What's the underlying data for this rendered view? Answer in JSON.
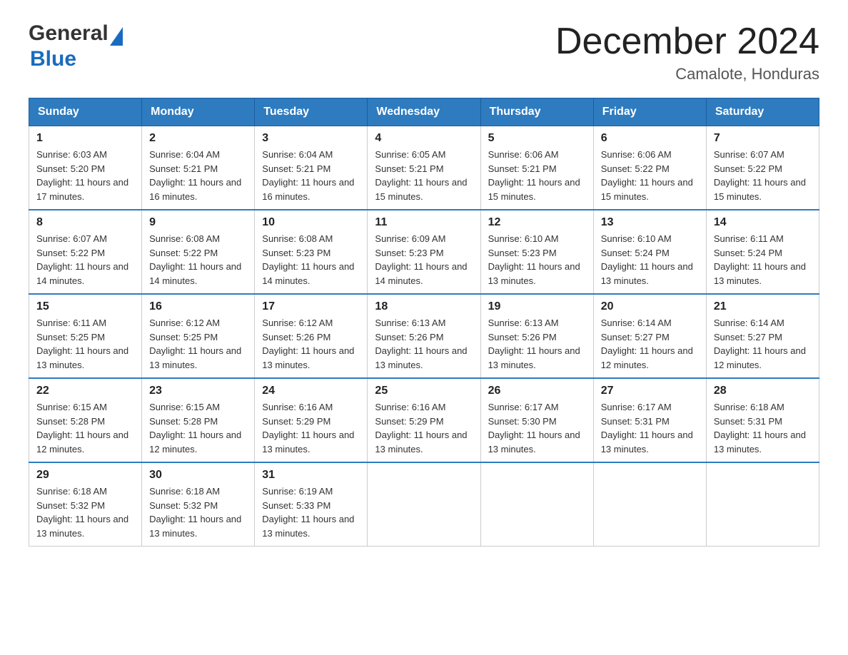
{
  "header": {
    "logo": {
      "text_general": "General",
      "text_blue": "Blue",
      "aria": "GeneralBlue logo"
    },
    "title": "December 2024",
    "subtitle": "Camalote, Honduras"
  },
  "calendar": {
    "weekdays": [
      "Sunday",
      "Monday",
      "Tuesday",
      "Wednesday",
      "Thursday",
      "Friday",
      "Saturday"
    ],
    "weeks": [
      [
        {
          "day": "1",
          "sunrise": "6:03 AM",
          "sunset": "5:20 PM",
          "daylight": "11 hours and 17 minutes."
        },
        {
          "day": "2",
          "sunrise": "6:04 AM",
          "sunset": "5:21 PM",
          "daylight": "11 hours and 16 minutes."
        },
        {
          "day": "3",
          "sunrise": "6:04 AM",
          "sunset": "5:21 PM",
          "daylight": "11 hours and 16 minutes."
        },
        {
          "day": "4",
          "sunrise": "6:05 AM",
          "sunset": "5:21 PM",
          "daylight": "11 hours and 15 minutes."
        },
        {
          "day": "5",
          "sunrise": "6:06 AM",
          "sunset": "5:21 PM",
          "daylight": "11 hours and 15 minutes."
        },
        {
          "day": "6",
          "sunrise": "6:06 AM",
          "sunset": "5:22 PM",
          "daylight": "11 hours and 15 minutes."
        },
        {
          "day": "7",
          "sunrise": "6:07 AM",
          "sunset": "5:22 PM",
          "daylight": "11 hours and 15 minutes."
        }
      ],
      [
        {
          "day": "8",
          "sunrise": "6:07 AM",
          "sunset": "5:22 PM",
          "daylight": "11 hours and 14 minutes."
        },
        {
          "day": "9",
          "sunrise": "6:08 AM",
          "sunset": "5:22 PM",
          "daylight": "11 hours and 14 minutes."
        },
        {
          "day": "10",
          "sunrise": "6:08 AM",
          "sunset": "5:23 PM",
          "daylight": "11 hours and 14 minutes."
        },
        {
          "day": "11",
          "sunrise": "6:09 AM",
          "sunset": "5:23 PM",
          "daylight": "11 hours and 14 minutes."
        },
        {
          "day": "12",
          "sunrise": "6:10 AM",
          "sunset": "5:23 PM",
          "daylight": "11 hours and 13 minutes."
        },
        {
          "day": "13",
          "sunrise": "6:10 AM",
          "sunset": "5:24 PM",
          "daylight": "11 hours and 13 minutes."
        },
        {
          "day": "14",
          "sunrise": "6:11 AM",
          "sunset": "5:24 PM",
          "daylight": "11 hours and 13 minutes."
        }
      ],
      [
        {
          "day": "15",
          "sunrise": "6:11 AM",
          "sunset": "5:25 PM",
          "daylight": "11 hours and 13 minutes."
        },
        {
          "day": "16",
          "sunrise": "6:12 AM",
          "sunset": "5:25 PM",
          "daylight": "11 hours and 13 minutes."
        },
        {
          "day": "17",
          "sunrise": "6:12 AM",
          "sunset": "5:26 PM",
          "daylight": "11 hours and 13 minutes."
        },
        {
          "day": "18",
          "sunrise": "6:13 AM",
          "sunset": "5:26 PM",
          "daylight": "11 hours and 13 minutes."
        },
        {
          "day": "19",
          "sunrise": "6:13 AM",
          "sunset": "5:26 PM",
          "daylight": "11 hours and 13 minutes."
        },
        {
          "day": "20",
          "sunrise": "6:14 AM",
          "sunset": "5:27 PM",
          "daylight": "11 hours and 12 minutes."
        },
        {
          "day": "21",
          "sunrise": "6:14 AM",
          "sunset": "5:27 PM",
          "daylight": "11 hours and 12 minutes."
        }
      ],
      [
        {
          "day": "22",
          "sunrise": "6:15 AM",
          "sunset": "5:28 PM",
          "daylight": "11 hours and 12 minutes."
        },
        {
          "day": "23",
          "sunrise": "6:15 AM",
          "sunset": "5:28 PM",
          "daylight": "11 hours and 12 minutes."
        },
        {
          "day": "24",
          "sunrise": "6:16 AM",
          "sunset": "5:29 PM",
          "daylight": "11 hours and 13 minutes."
        },
        {
          "day": "25",
          "sunrise": "6:16 AM",
          "sunset": "5:29 PM",
          "daylight": "11 hours and 13 minutes."
        },
        {
          "day": "26",
          "sunrise": "6:17 AM",
          "sunset": "5:30 PM",
          "daylight": "11 hours and 13 minutes."
        },
        {
          "day": "27",
          "sunrise": "6:17 AM",
          "sunset": "5:31 PM",
          "daylight": "11 hours and 13 minutes."
        },
        {
          "day": "28",
          "sunrise": "6:18 AM",
          "sunset": "5:31 PM",
          "daylight": "11 hours and 13 minutes."
        }
      ],
      [
        {
          "day": "29",
          "sunrise": "6:18 AM",
          "sunset": "5:32 PM",
          "daylight": "11 hours and 13 minutes."
        },
        {
          "day": "30",
          "sunrise": "6:18 AM",
          "sunset": "5:32 PM",
          "daylight": "11 hours and 13 minutes."
        },
        {
          "day": "31",
          "sunrise": "6:19 AM",
          "sunset": "5:33 PM",
          "daylight": "11 hours and 13 minutes."
        },
        null,
        null,
        null,
        null
      ]
    ]
  }
}
